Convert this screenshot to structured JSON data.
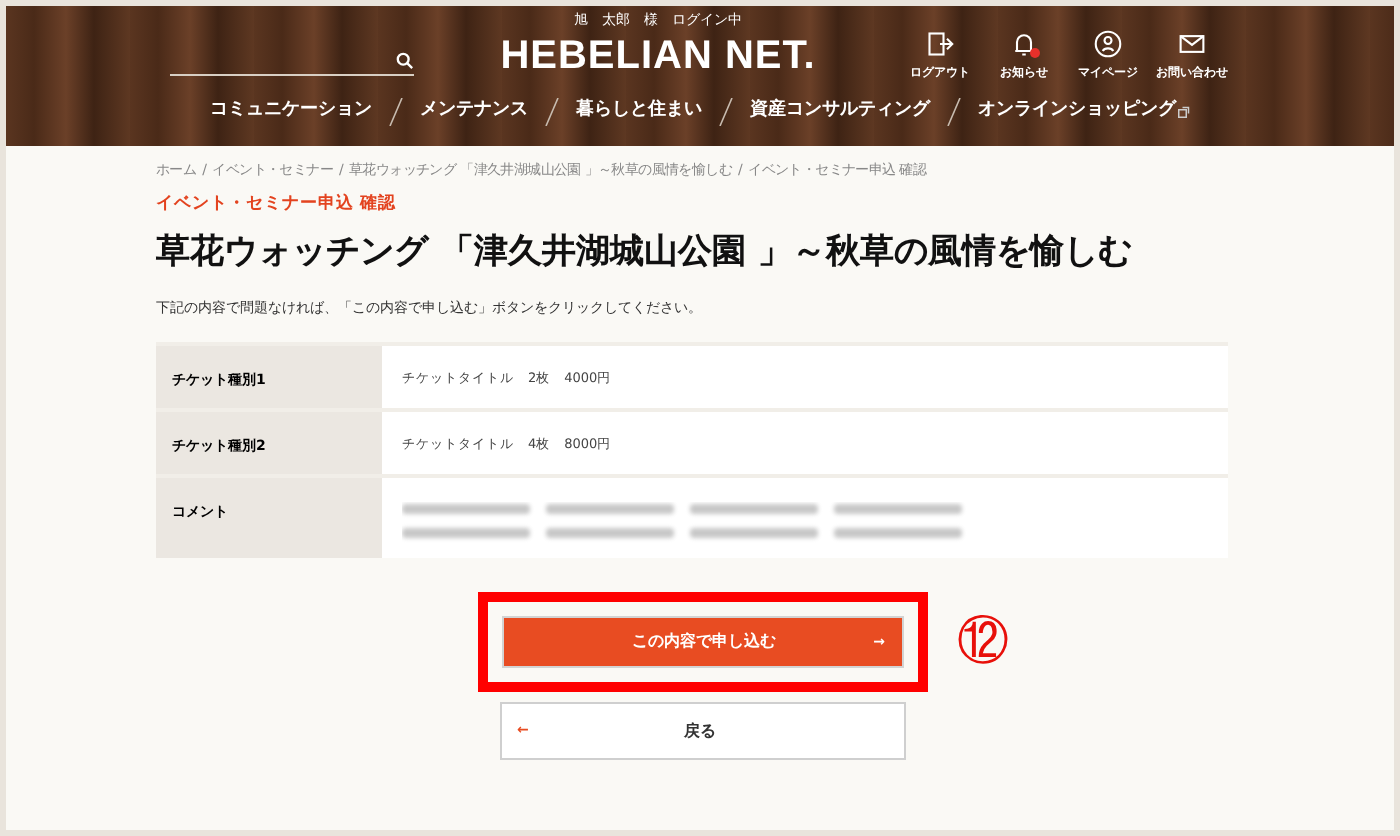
{
  "header": {
    "user_status": "旭　太郎　様　ログイン中",
    "logo": "HEBELIAN NET.",
    "icon_links": [
      {
        "kind": "logout",
        "label": "ログアウト",
        "badge": false
      },
      {
        "kind": "bell",
        "label": "お知らせ",
        "badge": true
      },
      {
        "kind": "user",
        "label": "マイページ",
        "badge": false
      },
      {
        "kind": "mail",
        "label": "お問い合わせ",
        "badge": false
      }
    ],
    "nav": [
      {
        "label": "コミュニケーション",
        "external": false
      },
      {
        "label": "メンテナンス",
        "external": false
      },
      {
        "label": "暮らしと住まい",
        "external": false
      },
      {
        "label": "資産コンサルティング",
        "external": false
      },
      {
        "label": "オンラインショッピング",
        "external": true
      }
    ]
  },
  "breadcrumb": [
    "ホーム",
    "イベント・セミナー",
    "草花ウォッチング 「津久井湖城山公園 」～秋草の風情を愉しむ",
    "イベント・セミナー申込 確認"
  ],
  "breadcrumb_separator": "/",
  "subtitle": "イベント・セミナー申込 確認",
  "title": "草花ウォッチング 「津久井湖城山公園 」～秋草の風情を愉しむ",
  "instruction": "下記の内容で問題なければ、「この内容で申し込む」ボタンをクリックしてください。",
  "table": {
    "rows": [
      {
        "label": "チケット種別1",
        "kind": "text",
        "value": "チケットタイトル　2枚　4000円"
      },
      {
        "label": "チケット種別2",
        "kind": "text",
        "value": "チケットタイトル　4枚　8000円"
      },
      {
        "label": "コメント",
        "kind": "blurred"
      }
    ]
  },
  "submit_button": {
    "label": "この内容で申し込む",
    "arrow": "→",
    "highlighted": true
  },
  "annotation": "⑫",
  "back_button": {
    "label": "戻る",
    "arrow": "←"
  }
}
